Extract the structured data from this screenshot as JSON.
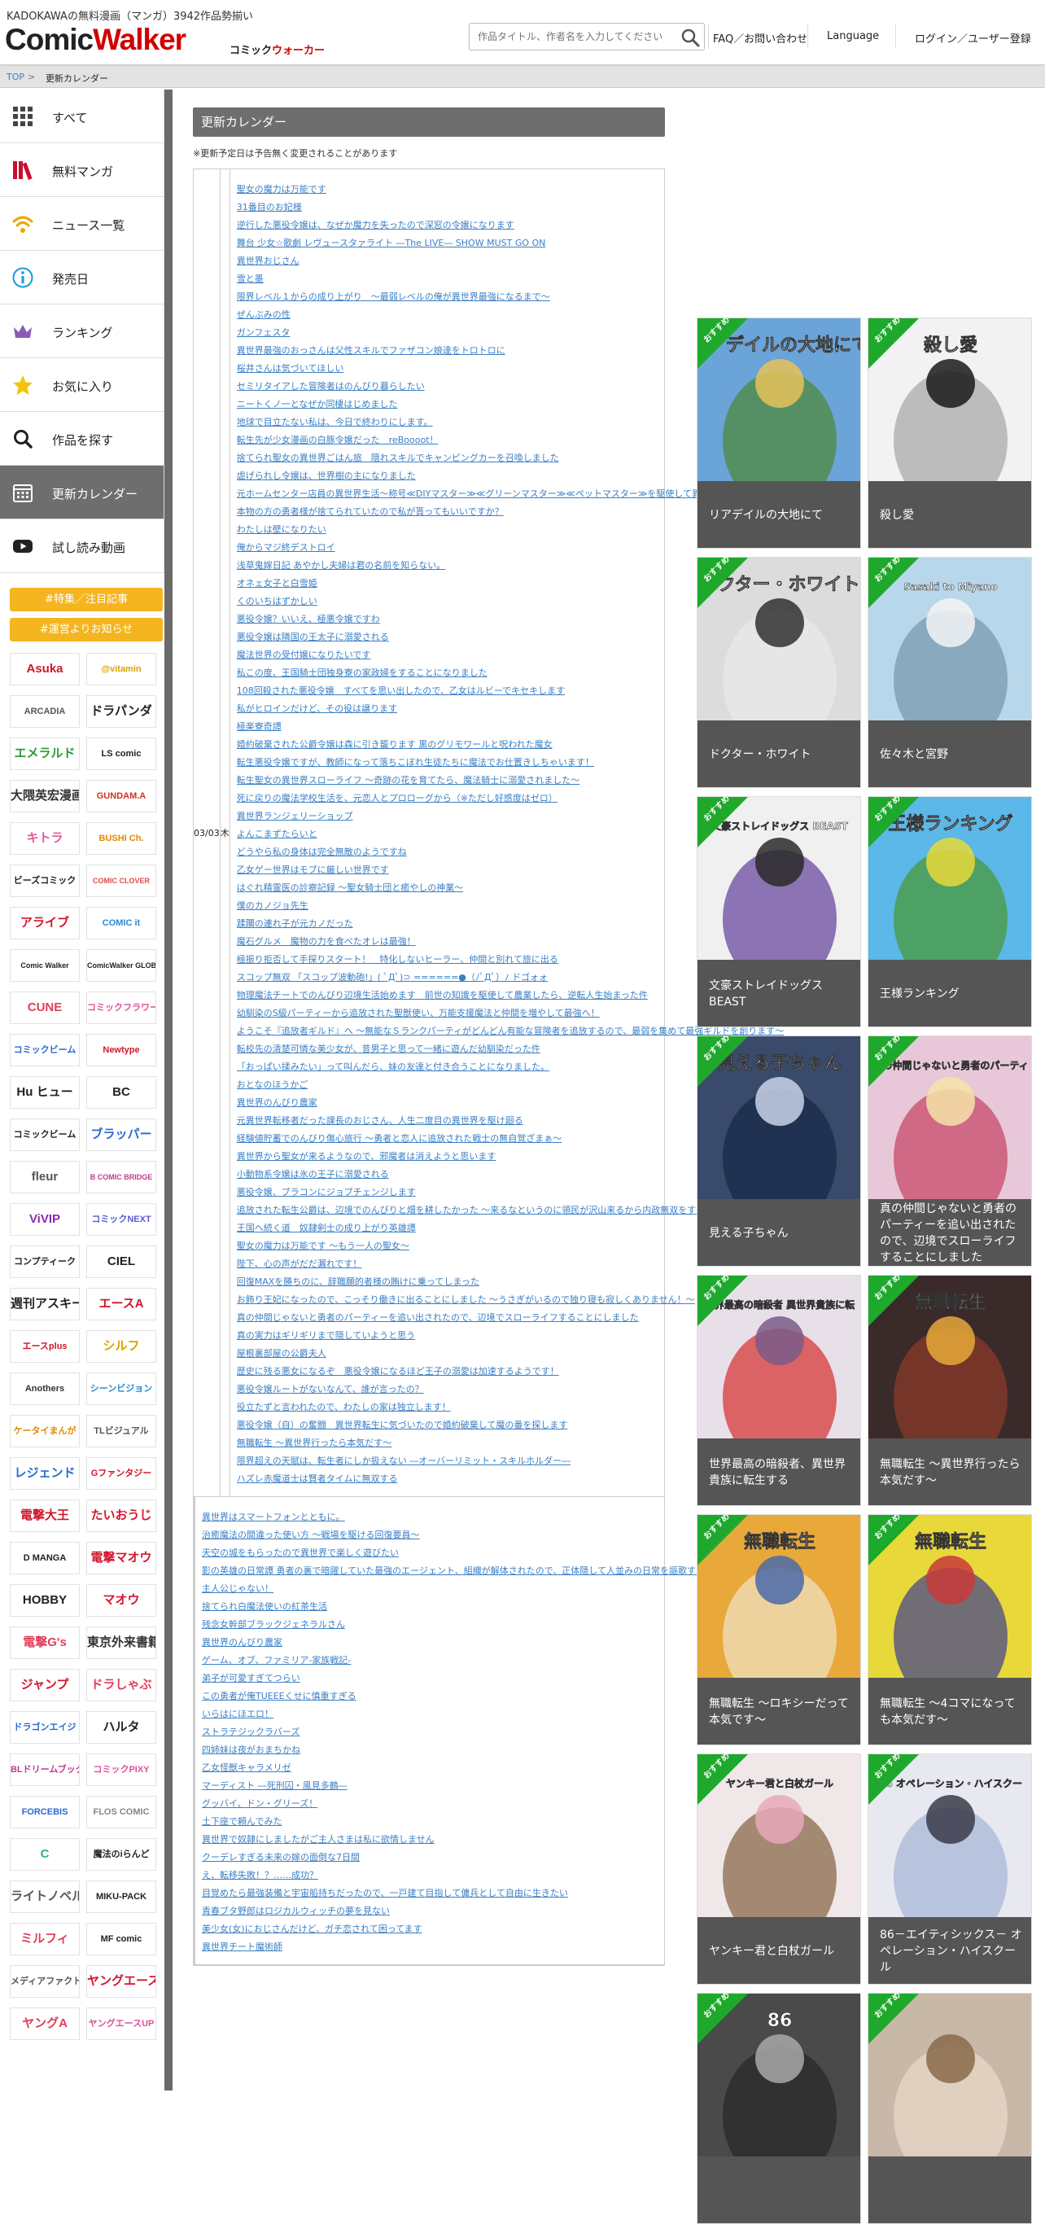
{
  "header": {
    "tagline": "KADOKAWAの無料漫画（マンガ）3942作品勢揃い",
    "logo_comic": "Comic",
    "logo_walker": "Walker",
    "logo_sub_a": "コミック",
    "logo_sub_b": "ウォーカー",
    "search_placeholder": "作品タイトル、作者名を入力してください",
    "faq": "FAQ／お問い合わせ",
    "language": "Language",
    "login": "ログイン／ユーザー登録"
  },
  "breadcrumb": {
    "top": "TOP",
    "sep": ">",
    "current": "更新カレンダー"
  },
  "sidebar": {
    "items": [
      {
        "label": "すべて",
        "icon": "grid-icon"
      },
      {
        "label": "無料マンガ",
        "icon": "books-icon"
      },
      {
        "label": "ニュース一覧",
        "icon": "wifi-icon"
      },
      {
        "label": "発売日",
        "icon": "info-icon"
      },
      {
        "label": "ランキング",
        "icon": "crown-icon"
      },
      {
        "label": "お気に入り",
        "icon": "star-icon"
      },
      {
        "label": "作品を探す",
        "icon": "search-icon"
      },
      {
        "label": "更新カレンダー",
        "icon": "calendar-icon"
      },
      {
        "label": "試し読み動画",
        "icon": "play-icon"
      }
    ],
    "buttons": [
      "#特集／注目記事",
      "#運営よりお知らせ"
    ],
    "brands": [
      {
        "name": "Asuka",
        "color": "#d2162d"
      },
      {
        "name": "@vitamin",
        "color": "#e0a000"
      },
      {
        "name": "ARCADIA",
        "color": "#555555"
      },
      {
        "name": "ドラパンダ",
        "color": "#222222"
      },
      {
        "name": "エメラルド",
        "color": "#2e9b3a"
      },
      {
        "name": "LS comic",
        "color": "#222222"
      },
      {
        "name": "大隈英宏漫画",
        "color": "#333333"
      },
      {
        "name": "GUNDAM.A",
        "color": "#d03020"
      },
      {
        "name": "キトラ",
        "color": "#e05a9c"
      },
      {
        "name": "BUSHI Ch.",
        "color": "#e08a00"
      },
      {
        "name": "ビーズコミック",
        "color": "#222222"
      },
      {
        "name": "COMIC CLOVER",
        "color": "#e04a4a"
      },
      {
        "name": "アライブ",
        "color": "#d2162d"
      },
      {
        "name": "COMIC it",
        "color": "#2a8ad2"
      },
      {
        "name": "Comic Walker",
        "color": "#222222"
      },
      {
        "name": "ComicWalker GLOBAL",
        "color": "#222222"
      },
      {
        "name": "CUNE",
        "color": "#e0405a"
      },
      {
        "name": "コミックフラワー",
        "color": "#e0509a"
      },
      {
        "name": "コミックビーム",
        "color": "#2a6ad2"
      },
      {
        "name": "Newtype",
        "color": "#d2162d"
      },
      {
        "name": "Hu ヒュー",
        "color": "#222222"
      },
      {
        "name": "BC",
        "color": "#222222"
      },
      {
        "name": "コミックビーム",
        "color": "#222222"
      },
      {
        "name": "ブラッパー",
        "color": "#2a6ad2"
      },
      {
        "name": "fleur",
        "color": "#555555"
      },
      {
        "name": "B COMIC BRIDGE",
        "color": "#c03a8a"
      },
      {
        "name": "ViVIP",
        "color": "#8a2ab2"
      },
      {
        "name": "コミックNEXT",
        "color": "#5a5ad2"
      },
      {
        "name": "コンプティーク",
        "color": "#222222"
      },
      {
        "name": "CIEL",
        "color": "#222222"
      },
      {
        "name": "週刊アスキー",
        "color": "#222222"
      },
      {
        "name": "エースA",
        "color": "#d2162d"
      },
      {
        "name": "エースplus",
        "color": "#d2162d"
      },
      {
        "name": "シルフ",
        "color": "#e0a000"
      },
      {
        "name": "Anothers",
        "color": "#333333"
      },
      {
        "name": "シーンビジョン",
        "color": "#2a8ad2"
      },
      {
        "name": "ケータイまんが",
        "color": "#e08a00"
      },
      {
        "name": "TLビジュアル",
        "color": "#555555"
      },
      {
        "name": "レジェンド",
        "color": "#2a6ad2"
      },
      {
        "name": "Gファンタジー",
        "color": "#d2162d"
      },
      {
        "name": "電撃大王",
        "color": "#d2162d"
      },
      {
        "name": "たいおうじ",
        "color": "#d2162d"
      },
      {
        "name": "D MANGA",
        "color": "#222222"
      },
      {
        "name": "電撃マオウ",
        "color": "#d2162d"
      },
      {
        "name": "HOBBY",
        "color": "#222222"
      },
      {
        "name": "マオウ",
        "color": "#d2162d"
      },
      {
        "name": "電撃G's",
        "color": "#e0405a"
      },
      {
        "name": "東京外来書籍",
        "color": "#333333"
      },
      {
        "name": "ジャンプ",
        "color": "#d2162d"
      },
      {
        "name": "ドラしゃぶ",
        "color": "#e0405a"
      },
      {
        "name": "ドラゴンエイジ",
        "color": "#2a6ad2"
      },
      {
        "name": "ハルタ",
        "color": "#222222"
      },
      {
        "name": "BLドリームブック",
        "color": "#c03a8a"
      },
      {
        "name": "コミックPIXY",
        "color": "#e0509a"
      },
      {
        "name": "FORCEBIS",
        "color": "#2a6ad2"
      },
      {
        "name": "FLOS COMIC",
        "color": "#888888"
      },
      {
        "name": "C",
        "color": "#2ab28a"
      },
      {
        "name": "魔法のiらんど",
        "color": "#222222"
      },
      {
        "name": "ライトノベル",
        "color": "#555555"
      },
      {
        "name": "MIKU-PACK",
        "color": "#222222"
      },
      {
        "name": "ミルフィ",
        "color": "#e0405a"
      },
      {
        "name": "MF comic",
        "color": "#222222"
      },
      {
        "name": "メディアファクトリー",
        "color": "#555555"
      },
      {
        "name": "ヤングエース",
        "color": "#d2162d"
      },
      {
        "name": "ヤングA",
        "color": "#e0405a"
      },
      {
        "name": "ヤングエースUP",
        "color": "#e0509a"
      }
    ]
  },
  "main": {
    "title": "更新カレンダー",
    "note": "※更新予定日は予告無く変更されることがあります",
    "rows": [
      {
        "date": "03/03",
        "day": "木",
        "titles": [
          "聖女の魔力は万能です",
          "31番目のお妃様",
          "逆行した悪役令嬢は、なぜか魔力を失ったので深窓の令嬢になります",
          "舞台 少女☆歌劇 レヴュースタァライト ―The LIVE― SHOW MUST GO ON",
          "異世界おじさん",
          "雪と墨",
          "限界レベル１からの成り上がり　～最弱レベルの俺が異世界最強になるまで～",
          "ぜんぶみの性",
          "ガンフェスタ",
          "異世界最強のおっさんは父性スキルでファザコン娘達をトロトロに",
          "桜井さんは気づいてほしい",
          "セミリタイアした冒険者はのんびり暮らしたい",
          "ニートくノ一となぜか同棲はじめました",
          "地球で目立たない私は、今日で終わりにします。",
          "転生先が少女漫画の白豚令嬢だった　reBoooot！",
          "捨てられ聖女の異世界ごはん旅　隠れスキルでキャンピングカーを召喚しました",
          "虐げられし令嬢は、世界樹の主になりました",
          "元ホームセンター店員の異世界生活～称号≪DIYマスター≫≪グリーンマスター≫≪ペットマスター≫を駆使して異世界を気儘に生きます～",
          "本物の方の勇者様が捨てられていたので私が貰ってもいいですか？",
          "わたしは壁になりたい",
          "俺からマジ終デストロイ",
          "浅草鬼嫁日記 あやかし夫婦は君の名前を知らない。",
          "オネェ女子と白雪姫",
          "くのいちはずかしい",
          "悪役令嬢？いいえ、極悪令嬢ですわ",
          "悪役令嬢は隣国の王太子に溺愛される",
          "魔法世界の受付嬢になりたいです",
          "私この度、王国騎士団独身寮の家政婦をすることになりました",
          "108回殺された悪役令嬢　すべてを思い出したので、乙女はルビーでキセキします",
          "私がヒロインだけど、その役は譲ります",
          "極楽寮奇譚",
          "婚約破棄された公爵令嬢は森に引き籠ります 黒のグリモワールと呪われた魔女",
          "転生悪役令嬢ですが、教師になって落ちこぼれ生徒たちに魔法でお仕置きしちゃいます！",
          "転生聖女の異世界スローライフ ～奇跡の花を育てたら、魔法騎士に溺愛されました～",
          "死に戻りの魔法学校生活を、元恋人とプロローグから（※ただし好感度はゼロ）",
          "異世界ランジェリーショップ",
          "よんこまずたらいと",
          "どうやら私の身体は完全無敵のようですね",
          "乙女ゲー世界はモブに厳しい世界です",
          "はぐれ精霊医の診察記録 ～聖女騎士団と癒やしの神業～",
          "僕のカノジョ先生",
          "蹂躙の連れ子が元カノだった",
          "魔石グルメ　魔物の力を食べたオレは最強！",
          "極振り拒否して手探りスタート！　特化しないヒーラー、仲間と別れて旅に出る",
          "スコップ無双 「スコップ波動砲!」( ﾟДﾟ)⊃ ======●（ﾉﾟДﾟ）ﾉ ドゴォォ",
          "物理魔法チートでのんびり辺境生活始めます　前世の知識を駆使して農業したら、逆転人生始まった件",
          "幼馴染のS級パーティーから追放された聖獣使い、万能支援魔法と仲間を増やして最強へ！",
          "ようこそ『追放者ギルド』へ ～無能なＳランクパーティがどんどん有能な冒険者を追放するので、最弱を集めて最強ギルドを創ります～",
          "転校先の清楚可憐な美少女が、昔男子と思って一緒に遊んだ幼馴染だった件",
          "「おっぱい揉みたい」って叫んだら、妹の友達と付き合うことになりました。",
          "おとなのほうかご",
          "異世界のんびり農家",
          "元異世界転移者だった課長のおじさん、人生二度目の異世界を駆け廻る",
          "経験値貯蓄でのんびり傷心旅行 ～勇者と恋人に追放された戦士の無自覚ざまぁ～",
          "異世界から聖女が来るようなので、邪魔者は消えようと思います",
          "小動物系令嬢は氷の王子に溺愛される",
          "悪役令嬢、ブラコンにジョブチェンジします",
          "追放された転生公爵は、辺境でのんびりと畑を耕したかった ～来るなというのに領民が沢山来るから内政無双をすることに～",
          "王国へ続く道　奴隷剣士の成り上がり英雄譚",
          "聖女の魔力は万能です ～もう一人の聖女～",
          "陛下、心の声がだだ漏れです！",
          "回復MAXを勝ちのに、辞職願的者様の賄けに乗ってしまった",
          "お飾り王妃になったので、こっそり働きに出ることにしました ～うさぎがいるので独り寝も寂しくありません！～",
          "真の仲間じゃないと勇者のパーティーを追い出されたので、辺境でスローライフすることにしました",
          "真の実力はギリギリまで隠していようと思う",
          "屋根裏部屋の公爵夫人",
          "歴史に残る悪女になるぞ　悪役令嬢になるほど王子の溺愛は加速するようです！",
          "悪役令嬢ルートがないなんて、誰が言ったの？",
          "役立たずと言われたので、わたしの家は独立します！",
          "悪役令嬢（自）の奮闘　異世界転生に気づいたので婚約破棄して魔の番を探します",
          "無職転生 ～異世界行ったら本気だす～",
          "限界超えの天賦は、転生者にしか扱えない ―オーバーリミット・スキルホルダー―",
          "ハズレ赤魔道士は賢者タイムに無双する"
        ]
      },
      {
        "date": "",
        "day": "",
        "titles": [
          "異世界はスマートフォンとともに。",
          "治癒魔法の間違った使い方 ～戦場を駆ける回復要員～",
          "天空の城をもらったので異世界で楽しく遊びたい",
          "影の英雄の日常譚 勇者の裏で暗躍していた最強のエージェント、組織が解体されたので、正体隠して人並みの日常を謳歌する。",
          "主人公じゃない！",
          "捨てられ白魔法使いの紅茶生活",
          "残念女幹部ブラックジェネラルさん",
          "異世界のんびり農家",
          "ゲーム、オブ、ファミリア-家族戦記-",
          "弟子が可愛すぎてつらい",
          "この勇者が俺TUEEEくせに慎重すぎる",
          "いらはにほエロ！",
          "ストラテジックラバーズ",
          "四姉妹は夜がおまちかね",
          "乙女怪獣キャラメリゼ",
          "マーディスト ―死刑囚・風見多鶴―",
          "グッバイ、ドン・グリーズ！",
          "土下座で頼んでみた",
          "異世界で奴隷にしましたがご主人さまは私に欲情しません",
          "クーデレすぎる未来の嫁の面倒な7日間",
          "え、転移失敗！？……成功？",
          "目覚めたら最強装備と宇宙船持ちだったので、一戸建て目指して傭兵として自由に生きたい",
          "青春ブタ野郎はロジカルウィッチの夢を見ない",
          "美少女(女)におじさんだけど、ガチ恋されて困ってます",
          "異世界チート魔術師"
        ]
      }
    ]
  },
  "recommend": {
    "badge": "おすすめ",
    "cards": [
      {
        "title": "リアデイルの大地にて",
        "cover_text": "リアデイルの大地にて",
        "palette": [
          "#6aa4d8",
          "#e6c25a",
          "#4f8a3e"
        ]
      },
      {
        "title": "殺し愛",
        "cover_text": "殺し愛",
        "palette": [
          "#f2f2f2",
          "#1a1a1a",
          "#aaaaaa"
        ]
      },
      {
        "title": "ドクター・ホワイト",
        "cover_text": "ドクター・ホワイト",
        "palette": [
          "#dcdcdc",
          "#303030",
          "#eaeaea"
        ]
      },
      {
        "title": "佐々木と宮野",
        "cover_text": "Sasaki to Miyano",
        "palette": [
          "#b9d7ea",
          "#f4f4f4",
          "#7a9ab0"
        ]
      },
      {
        "title": "文豪ストレイドッグス BEAST",
        "cover_text": "文豪ストレイドッグス BEAST",
        "palette": [
          "#f0f0f0",
          "#2a2a2a",
          "#6a4aa0"
        ]
      },
      {
        "title": "王様ランキング",
        "cover_text": "王様ランキング",
        "palette": [
          "#5bb8e8",
          "#e8d83a",
          "#4a9a3a"
        ]
      },
      {
        "title": "見える子ちゃん",
        "cover_text": "見える子ちゃん",
        "palette": [
          "#3a4a6a",
          "#c8d4e8",
          "#1a2a4a"
        ]
      },
      {
        "title": "真の仲間じゃないと勇者のパーティーを追い出されたので、辺境でスローライフすることにしました",
        "cover_text": "真の仲間じゃないと勇者のパーティーを追い出されたので",
        "palette": [
          "#e8c8d8",
          "#f4e4a8",
          "#c84a6a"
        ]
      },
      {
        "title": "世界最高の暗殺者、異世界貴族に転生する",
        "cover_text": "世界最高の暗殺者 異世界貴族に転生する",
        "palette": [
          "#e8e0e8",
          "#7a5a8a",
          "#d83a3a"
        ]
      },
      {
        "title": "無職転生 ～異世界行ったら本気だす～",
        "cover_text": "無職転生",
        "palette": [
          "#3a2a2a",
          "#e8a83a",
          "#8a3a2a"
        ]
      },
      {
        "title": "無職転生 ～ロキシーだって本気です～",
        "cover_text": "無職転生",
        "palette": [
          "#e8a83a",
          "#4a6aa8",
          "#f0e0c0"
        ]
      },
      {
        "title": "無職転生 ～4コマになっても本気だす～",
        "cover_text": "無職転生",
        "palette": [
          "#e8d83a",
          "#c83a3a",
          "#4a4a8a"
        ]
      },
      {
        "title": "ヤンキー君と白杖ガール",
        "cover_text": "ヤンキー君と白杖ガール",
        "palette": [
          "#f0e8e8",
          "#e8a8b8",
          "#8a6a4a"
        ]
      },
      {
        "title": "86－エイティシックス－ オペレーション・ハイスクール",
        "cover_text": "86 オペレーション・ハイスクール",
        "palette": [
          "#e8e8f0",
          "#3a3a4a",
          "#a8b8d8"
        ]
      },
      {
        "title": "",
        "cover_text": "86",
        "palette": [
          "#4a4a4a",
          "#a8a8a8",
          "#2a2a2a"
        ]
      },
      {
        "title": "",
        "cover_text": "",
        "palette": [
          "#c8b8a8",
          "#8a6a4a",
          "#e8d8c8"
        ]
      }
    ]
  }
}
